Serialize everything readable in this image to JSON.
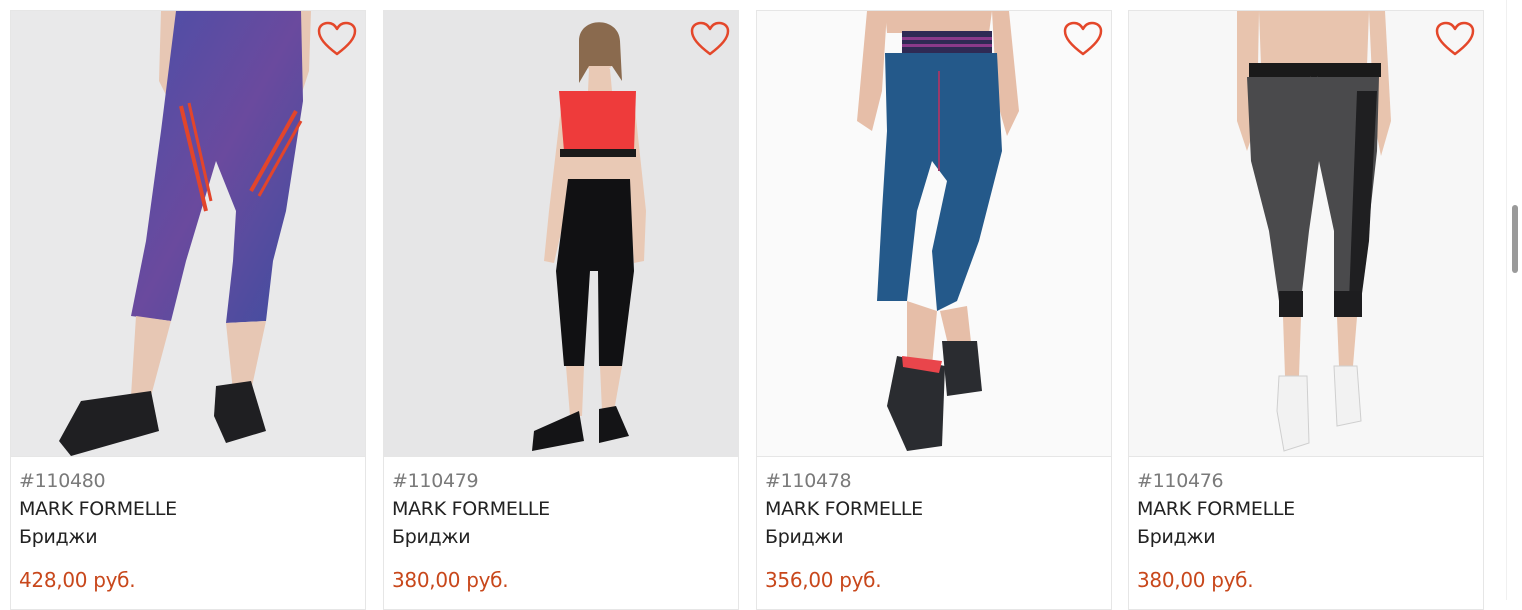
{
  "colors": {
    "price": "#c8471b",
    "heart": "#e4472a",
    "sku": "#7a7a7a",
    "text": "#222222"
  },
  "products": [
    {
      "sku": "#110480",
      "brand": "MARK FORMELLE",
      "name": "Бриджи",
      "price": "428,00 руб.",
      "favorite_icon": "heart-outline-icon",
      "image": "product-photo-patterned-blue-red-leggings"
    },
    {
      "sku": "#110479",
      "brand": "MARK FORMELLE",
      "name": "Бриджи",
      "price": "380,00 руб.",
      "favorite_icon": "heart-outline-icon",
      "image": "product-photo-black-capri-leggings"
    },
    {
      "sku": "#110478",
      "brand": "MARK FORMELLE",
      "name": "Бриджи",
      "price": "356,00 руб.",
      "favorite_icon": "heart-outline-icon",
      "image": "product-photo-blue-capri-leggings"
    },
    {
      "sku": "#110476",
      "brand": "MARK FORMELLE",
      "name": "Бриджи",
      "price": "380,00 руб.",
      "favorite_icon": "heart-outline-icon",
      "image": "product-photo-grey-jogger-capri"
    }
  ]
}
